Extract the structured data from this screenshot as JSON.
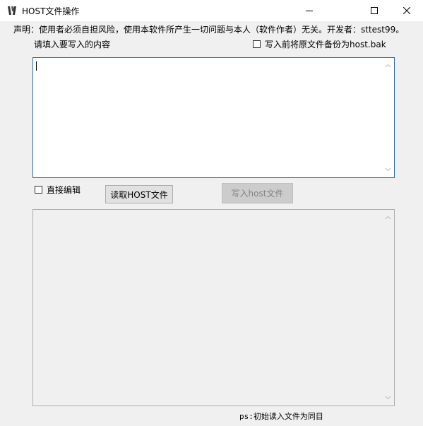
{
  "window": {
    "title": "HOST文件操作",
    "icon": "app-logo-icon",
    "controls": [
      "minimize-icon",
      "maximize-icon",
      "close-icon"
    ]
  },
  "disclaimer": "声明：使用者必须自担风险，使用本软件所产生一切问题与本人（软件作者）无关。开发者：sttest99。",
  "content_prompt": "请填入要写入的内容",
  "backup_checkbox": {
    "label": "写入前将原文件备份为host.bak",
    "checked": false
  },
  "input_text": "",
  "direct_edit_checkbox": {
    "label": "直接编辑",
    "checked": false
  },
  "buttons": {
    "read": "读取HOST文件",
    "write": "写入host文件"
  },
  "write_button_enabled": false,
  "output_text": "",
  "status_text": "ps:初始读入文件为同目"
}
